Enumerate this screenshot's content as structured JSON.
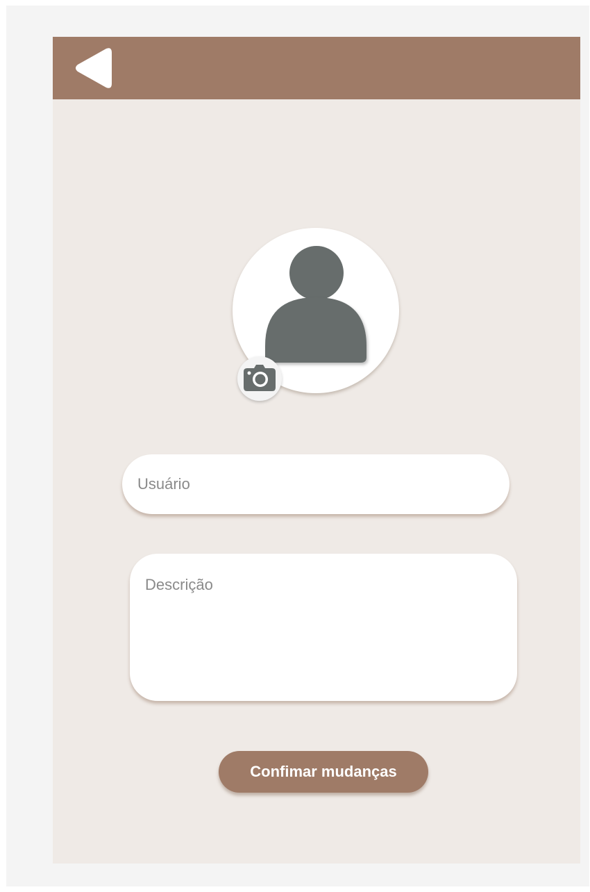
{
  "colors": {
    "header_background": "#9f7b67",
    "screen_background": "#efeae6",
    "avatar_figure": "#676d6c",
    "button_background": "#9f7b67",
    "button_text": "#ffffff"
  },
  "header": {
    "back_icon": "triangle-left-icon"
  },
  "profile": {
    "avatar_icon": "person-icon",
    "camera_icon": "camera-icon"
  },
  "form": {
    "username": {
      "value": "",
      "placeholder": "Usuário"
    },
    "description": {
      "value": "",
      "placeholder": "Descrição"
    },
    "confirm_label": "Confimar mudanças"
  }
}
